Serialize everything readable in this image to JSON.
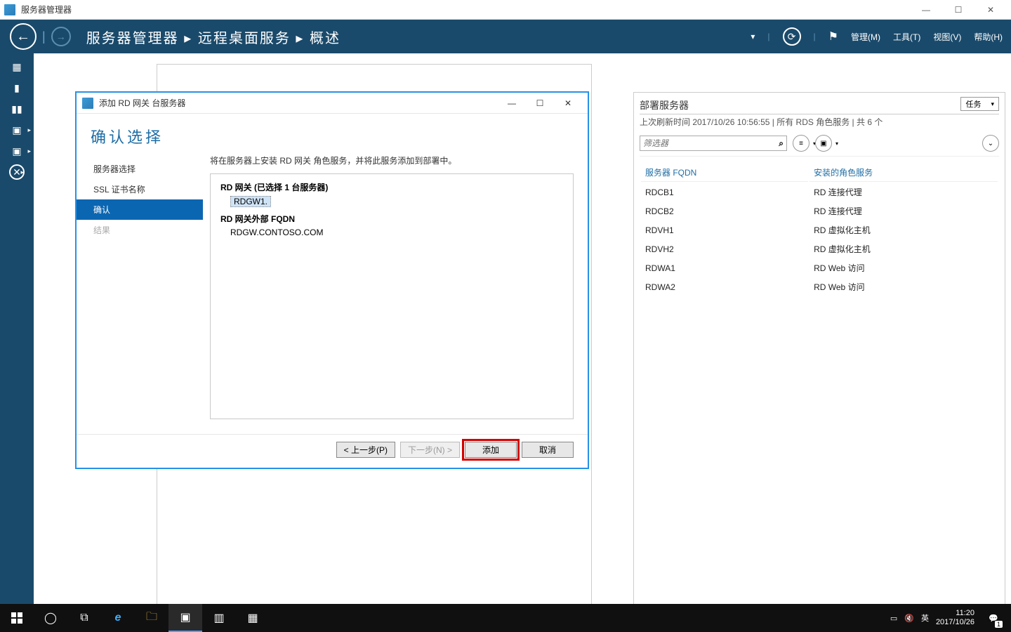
{
  "app_title": "服务器管理器",
  "window_controls": {
    "min": "—",
    "max": "☐",
    "close": "✕"
  },
  "breadcrumb": "服务器管理器 ▸ 远程桌面服务 ▸ 概述",
  "header_menu": {
    "manage": "管理(M)",
    "tools": "工具(T)",
    "view": "视图(V)",
    "help": "帮助(H)"
  },
  "header_icons": {
    "refresh": "⟳",
    "flag": "⚑",
    "caret": "▾",
    "lsep": "|"
  },
  "leftnav": [
    {
      "id": "dashboard",
      "glyph": "▦"
    },
    {
      "id": "local",
      "glyph": "▮"
    },
    {
      "id": "allservers",
      "glyph": "▮▮"
    },
    {
      "id": "iis",
      "glyph": "▣"
    },
    {
      "id": "rds",
      "glyph": "▣"
    },
    {
      "id": "roles",
      "glyph": "✕"
    }
  ],
  "deploy": {
    "title": "部署服务器",
    "subtitle": "上次刷新时间 2017/10/26 10:56:55 | 所有 RDS 角色服务 | 共 6 个",
    "tasks_label": "任务",
    "filter_placeholder": "筛选器",
    "search_icon": "⌕",
    "toolbar_icons": {
      "list": "≡",
      "save": "▣",
      "expand": "⌄"
    },
    "columns": [
      "服务器 FQDN",
      "安装的角色服务"
    ],
    "rows": [
      {
        "fqdn": "RDCB1",
        "role": "RD 连接代理"
      },
      {
        "fqdn": "RDCB2",
        "role": "RD 连接代理"
      },
      {
        "fqdn": "RDVH1",
        "role": "RD 虚拟化主机"
      },
      {
        "fqdn": "RDVH2",
        "role": "RD 虚拟化主机"
      },
      {
        "fqdn": "RDWA1",
        "role": "RD Web 访问"
      },
      {
        "fqdn": "RDWA2",
        "role": "RD Web 访问"
      }
    ]
  },
  "wizard": {
    "window_title": "添加 RD 网关 台服务器",
    "heading": "确认选择",
    "nav": [
      {
        "key": "server_select",
        "label": "服务器选择",
        "state": "normal"
      },
      {
        "key": "ssl_name",
        "label": "SSL 证书名称",
        "state": "normal"
      },
      {
        "key": "confirm",
        "label": "确认",
        "state": "active"
      },
      {
        "key": "result",
        "label": "结果",
        "state": "disabled"
      }
    ],
    "description": "将在服务器上安装 RD 网关 角色服务，并将此服务添加到部署中。",
    "section1_title": "RD 网关  (已选择 1 台服务器)",
    "selected_server": "RDGW1.",
    "section2_title": "RD 网关外部 FQDN",
    "external_fqdn": "RDGW.CONTOSO.COM",
    "buttons": {
      "prev": "< 上一步(P)",
      "next": "下一步(N) >",
      "add": "添加",
      "cancel": "取消"
    }
  },
  "taskbar": {
    "items": [
      "start",
      "search",
      "taskview",
      "ie",
      "explorer",
      "servermgr",
      "app1",
      "app2"
    ],
    "tray": {
      "action_center": "▭",
      "sound_muted": "🔇",
      "ime": "英",
      "time": "11:20",
      "date": "2017/10/26",
      "notif_badge": "1"
    }
  }
}
